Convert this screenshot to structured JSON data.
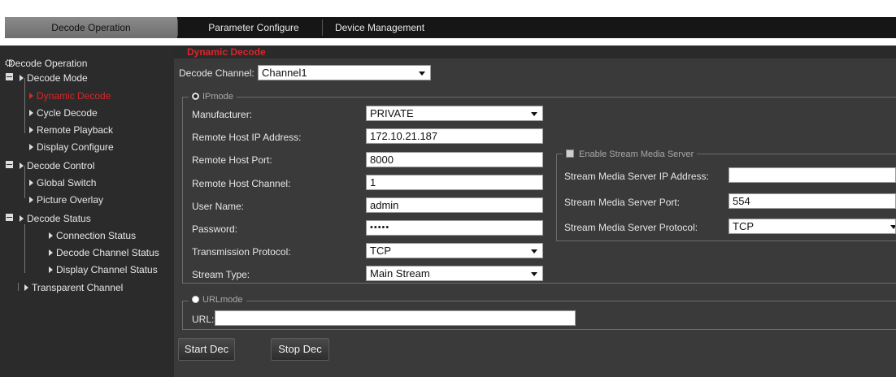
{
  "tabs": [
    {
      "label": "Decode Operation",
      "active": true
    },
    {
      "label": "Parameter Configure",
      "active": false
    },
    {
      "label": "Device Management",
      "active": false
    }
  ],
  "sidebar": {
    "root_label": "Decode Operation",
    "groups": [
      {
        "label": "Decode Mode",
        "items": [
          "Dynamic Decode",
          "Cycle Decode",
          "Remote Playback",
          "Display Configure"
        ]
      },
      {
        "label": "Decode Control",
        "items": [
          "Global Switch",
          "Picture Overlay"
        ]
      },
      {
        "label": "Decode Status",
        "items": [
          "Connection Status",
          "Decode Channel Status",
          "Display Channel Status"
        ]
      }
    ],
    "extra_item": "Transparent Channel",
    "selected_item": "Dynamic Decode"
  },
  "main": {
    "section_title": "Dynamic Decode",
    "decode_channel": {
      "label": "Decode Channel:",
      "value": "Channel1"
    },
    "ipmode": {
      "legend": "IPmode",
      "selected": true,
      "fields": [
        {
          "label": "Manufacturer:",
          "value": "PRIVATE",
          "type": "select"
        },
        {
          "label": "Remote Host IP Address:",
          "value": "172.10.21.187",
          "type": "text"
        },
        {
          "label": "Remote Host Port:",
          "value": "8000",
          "type": "text"
        },
        {
          "label": "Remote Host Channel:",
          "value": "1",
          "type": "text"
        },
        {
          "label": "User Name:",
          "value": "admin",
          "type": "text"
        },
        {
          "label": "Password:",
          "value": "•••••",
          "type": "password"
        },
        {
          "label": "Transmission Protocol:",
          "value": "TCP",
          "type": "select"
        },
        {
          "label": "Stream Type:",
          "value": "Main Stream",
          "type": "select"
        }
      ]
    },
    "stream_media": {
      "legend": "Enable Stream Media Server",
      "enabled": false,
      "fields": [
        {
          "label": "Stream Media Server IP Address:",
          "value": "",
          "type": "text"
        },
        {
          "label": "Stream Media Server Port:",
          "value": "554",
          "type": "text"
        },
        {
          "label": "Stream Media Server Protocol:",
          "value": "TCP",
          "type": "select"
        }
      ]
    },
    "urlmode": {
      "legend": "URLmode",
      "selected": false,
      "url_label": "URL:",
      "url_value": ""
    },
    "buttons": {
      "start": "Start Dec",
      "stop": "Stop Dec"
    }
  },
  "colors": {
    "accent_red": "#d8262a",
    "tab_active": "#7c7c7c",
    "panel_bg": "#3a3a3a",
    "sidebar_bg": "#2b2b2b"
  }
}
